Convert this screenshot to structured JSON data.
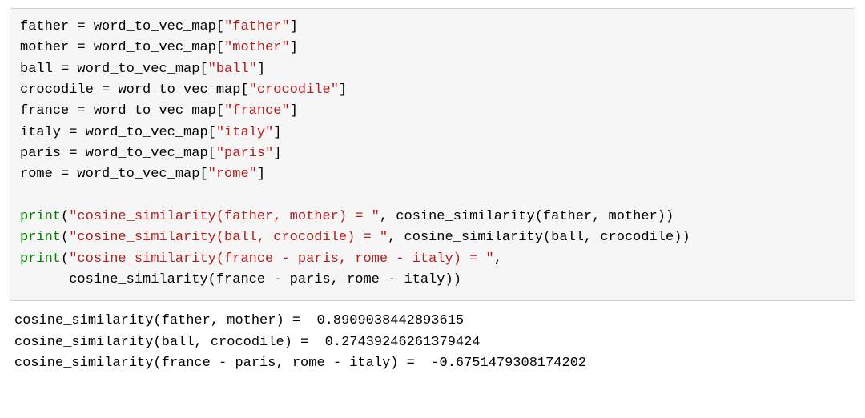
{
  "code": {
    "assign": [
      {
        "var": "father",
        "map": "word_to_vec_map",
        "key": "\"father\""
      },
      {
        "var": "mother",
        "map": "word_to_vec_map",
        "key": "\"mother\""
      },
      {
        "var": "ball",
        "map": "word_to_vec_map",
        "key": "\"ball\""
      },
      {
        "var": "crocodile",
        "map": "word_to_vec_map",
        "key": "\"crocodile\""
      },
      {
        "var": "france",
        "map": "word_to_vec_map",
        "key": "\"france\""
      },
      {
        "var": "italy",
        "map": "word_to_vec_map",
        "key": "\"italy\""
      },
      {
        "var": "paris",
        "map": "word_to_vec_map",
        "key": "\"paris\""
      },
      {
        "var": "rome",
        "map": "word_to_vec_map",
        "key": "\"rome\""
      }
    ],
    "prints": {
      "p1": {
        "kw": "print",
        "open": "(",
        "str": "\"cosine_similarity(father, mother) = \"",
        "comma": ", ",
        "call": "cosine_similarity(father, mother))"
      },
      "p2": {
        "kw": "print",
        "open": "(",
        "str": "\"cosine_similarity(ball, crocodile) = \"",
        "comma": ", ",
        "call": "cosine_similarity(ball, crocodile))"
      },
      "p3a": {
        "kw": "print",
        "open": "(",
        "str": "\"cosine_similarity(france - paris, rome - italy) = \"",
        "comma": ","
      },
      "p3b": {
        "indent": "      ",
        "call": "cosine_similarity(france - paris, rome - italy))"
      }
    }
  },
  "output": {
    "line1": "cosine_similarity(father, mother) =  0.8909038442893615",
    "line2": "cosine_similarity(ball, crocodile) =  0.27439246261379424",
    "line3": "cosine_similarity(france - paris, rome - italy) =  -0.6751479308174202"
  }
}
